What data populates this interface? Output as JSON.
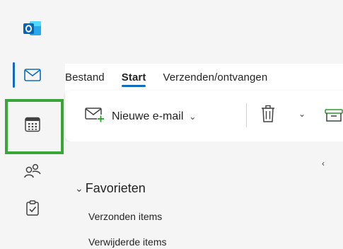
{
  "nav": {
    "items": [
      {
        "name": "mail",
        "icon": "mail-icon",
        "active": true
      },
      {
        "name": "calendar",
        "icon": "calendar-icon",
        "highlighted": true
      },
      {
        "name": "people",
        "icon": "people-icon"
      },
      {
        "name": "tasks",
        "icon": "clipboard-check-icon"
      }
    ]
  },
  "tabs": [
    "Bestand",
    "Start",
    "Verzenden/ontvangen"
  ],
  "selected_tab": "Start",
  "ribbon": {
    "new_mail_label": "Nieuwe e-mail",
    "new_mail_chevron": "⌄",
    "delete_chevron": "⌄"
  },
  "folders": {
    "collapse_glyph": "‹",
    "favorites_caret": "⌄",
    "favorites_label": "Favorieten",
    "items": [
      "Verzonden items",
      "Verwijderde items"
    ]
  },
  "colors": {
    "accent": "#0f6cbd",
    "highlight_box": "#3aa63a",
    "new_mail_plus": "#2a9d2a"
  }
}
